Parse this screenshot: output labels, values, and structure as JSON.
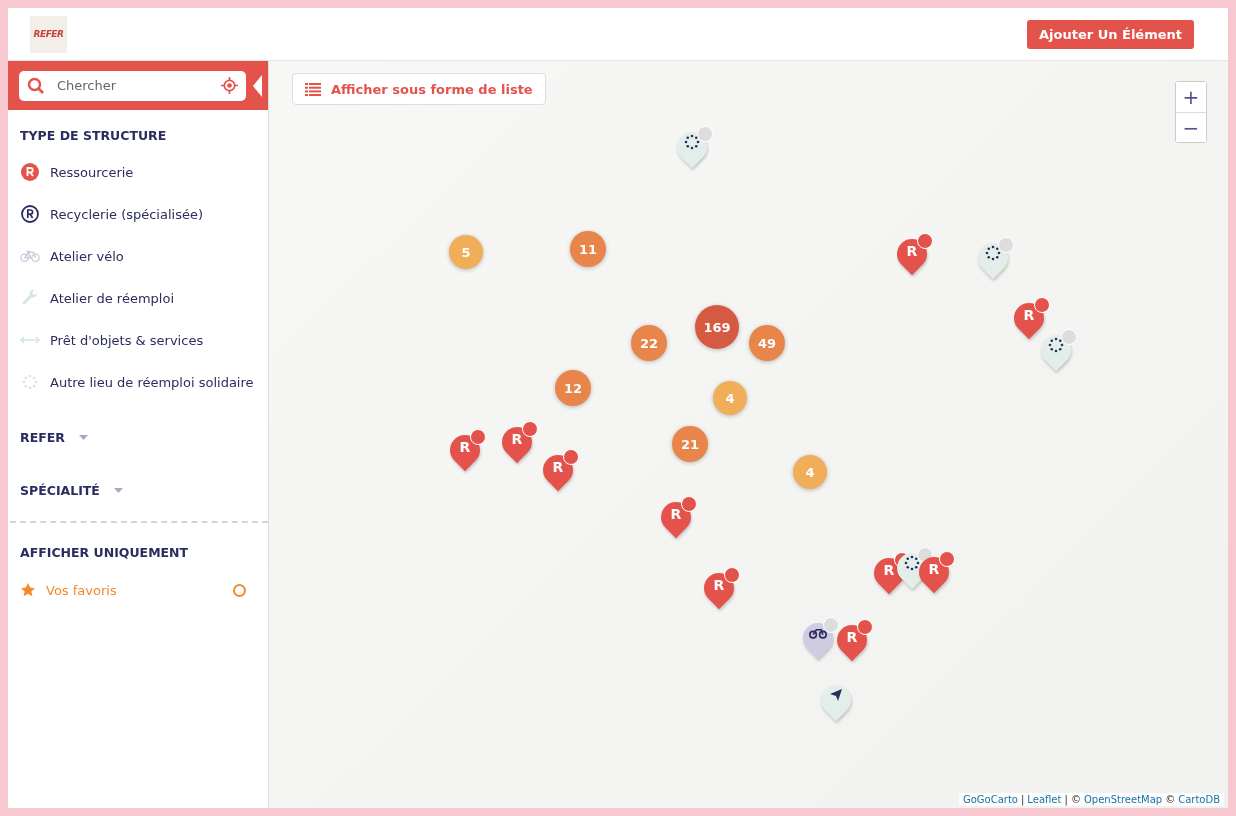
{
  "header": {
    "logo_text": "REFER",
    "add_button": "Ajouter Un Élément"
  },
  "search": {
    "placeholder": "Chercher"
  },
  "sidebar": {
    "title": "TYPE DE STRUCTURE",
    "categories": [
      {
        "label": "Ressourcerie",
        "kind": "ressourcerie"
      },
      {
        "label": "Recyclerie (spécialisée)",
        "kind": "recyclerie"
      },
      {
        "label": "Atelier vélo",
        "kind": "velo"
      },
      {
        "label": "Atelier de réemploi",
        "kind": "atelier"
      },
      {
        "label": "Prêt d'objets & services",
        "kind": "pret"
      },
      {
        "label": "Autre lieu de réemploi solidaire",
        "kind": "autre"
      }
    ],
    "filters": [
      {
        "label": "REFER",
        "expanded": false
      },
      {
        "label": "SPÉCIALITÉ",
        "expanded": false
      }
    ],
    "only_title": "AFFICHER UNIQUEMENT",
    "favorites": {
      "label": "Vos favoris",
      "checked": false
    }
  },
  "map": {
    "list_button": "Afficher sous forme de liste",
    "zoom_in": "+",
    "zoom_out": "−",
    "clusters": [
      {
        "count": "5",
        "color": "#f0ae58"
      },
      {
        "count": "11",
        "color": "#e8854a"
      },
      {
        "count": "169",
        "color": "#d65a41"
      },
      {
        "count": "22",
        "color": "#e8854a"
      },
      {
        "count": "49",
        "color": "#e8854a"
      },
      {
        "count": "12",
        "color": "#e8854a"
      },
      {
        "count": "4",
        "color": "#f0ae58"
      },
      {
        "count": "21",
        "color": "#e8854a"
      },
      {
        "count": "4",
        "color": "#f0ae58"
      }
    ],
    "pins": [
      {
        "kind": "autre"
      },
      {
        "kind": "ressourcerie",
        "label": "R"
      },
      {
        "kind": "autre"
      },
      {
        "kind": "ressourcerie",
        "label": "R"
      },
      {
        "kind": "autre"
      },
      {
        "kind": "ressourcerie",
        "label": "R"
      },
      {
        "kind": "ressourcerie",
        "label": "R"
      },
      {
        "kind": "ressourcerie",
        "label": "R"
      },
      {
        "kind": "ressourcerie",
        "label": "R"
      },
      {
        "kind": "ressourcerie",
        "label": "R"
      },
      {
        "kind": "ressourcerie",
        "label": "R"
      },
      {
        "kind": "autre"
      },
      {
        "kind": "ressourcerie",
        "label": "R"
      },
      {
        "kind": "velo"
      },
      {
        "kind": "ressourcerie",
        "label": "R"
      },
      {
        "kind": "arrow"
      }
    ],
    "attribution": [
      {
        "kind": "link",
        "text": "GoGoCarto"
      },
      {
        "kind": "text",
        "text": "|"
      },
      {
        "kind": "link",
        "text": "Leaflet"
      },
      {
        "kind": "text",
        "text": "| ©"
      },
      {
        "kind": "link",
        "text": "OpenStreetMap"
      },
      {
        "kind": "text",
        "text": "©"
      },
      {
        "kind": "link",
        "text": "CartoDB"
      }
    ]
  }
}
